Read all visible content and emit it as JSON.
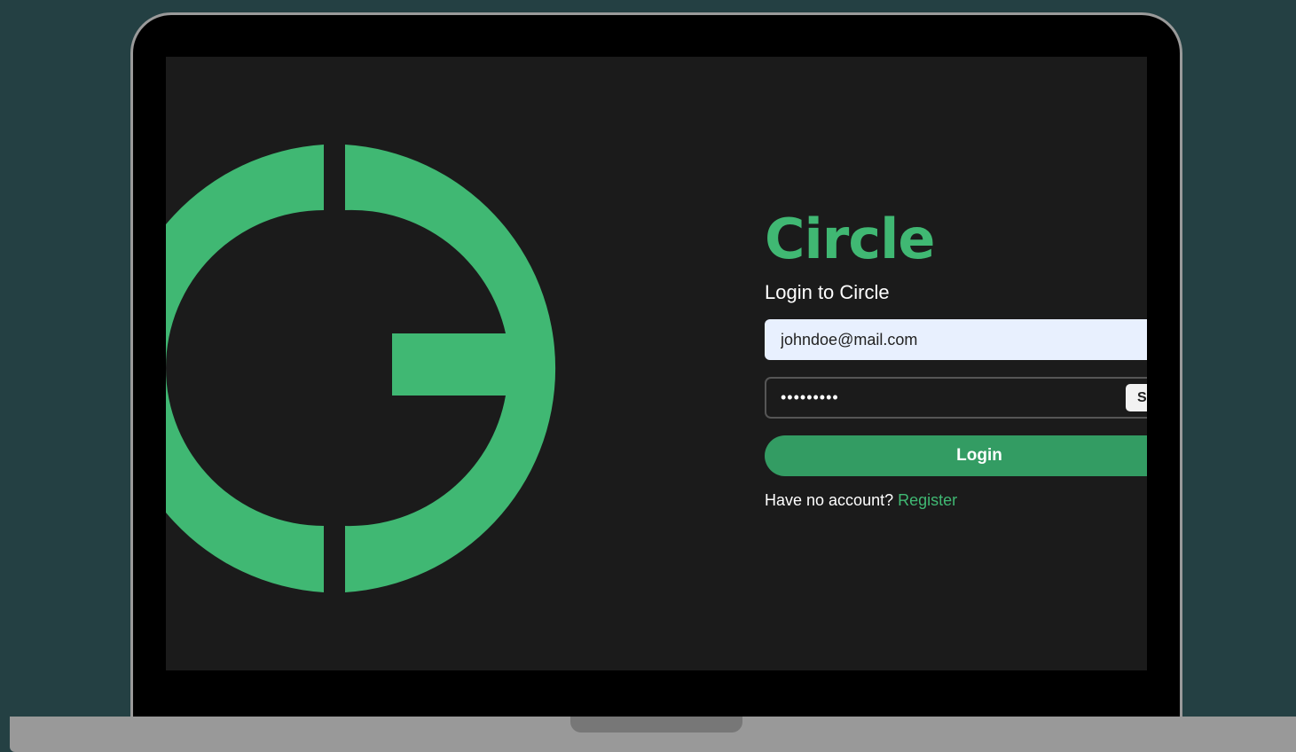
{
  "colors": {
    "background": "#244043",
    "screen": "#1b1b1b",
    "brand_green": "#40b873",
    "button_green": "#339c63",
    "input_fill": "#e8f0fe"
  },
  "logo": {
    "icon": "circle-logo-icon"
  },
  "login": {
    "brand_title": "Circle",
    "subtitle": "Login to Circle",
    "email_value": "johndoe@mail.com",
    "password_value": "•••••••••",
    "show_password_label": "S",
    "login_button_label": "Login",
    "no_account_text": "Have no account?",
    "register_link_label": "Register"
  }
}
